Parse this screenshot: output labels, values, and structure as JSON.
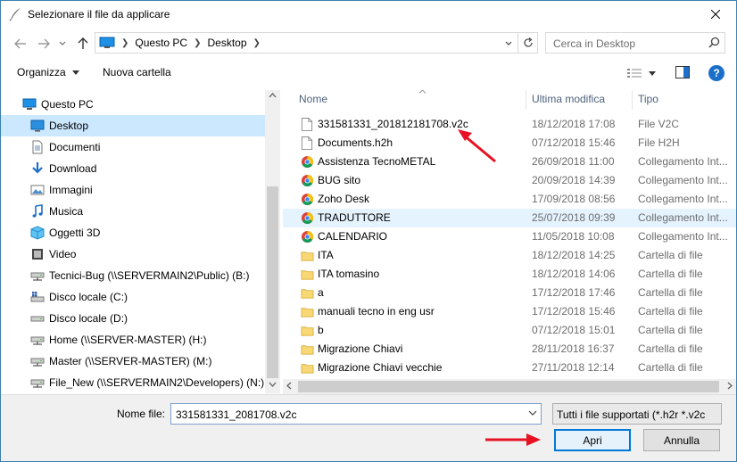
{
  "window": {
    "title": "Selezionare il file da applicare"
  },
  "address": {
    "crumbs": [
      "Questo PC",
      "Desktop"
    ]
  },
  "search": {
    "placeholder": "Cerca in Desktop"
  },
  "toolbar": {
    "organize": "Organizza",
    "new_folder": "Nuova cartella",
    "help": "?"
  },
  "nav": {
    "items": [
      {
        "label": "Questo PC",
        "icon": "pc-icon"
      },
      {
        "label": "Desktop",
        "icon": "desktop-icon",
        "selected": true
      },
      {
        "label": "Documenti",
        "icon": "documents-icon"
      },
      {
        "label": "Download",
        "icon": "download-icon"
      },
      {
        "label": "Immagini",
        "icon": "pictures-icon"
      },
      {
        "label": "Musica",
        "icon": "music-icon"
      },
      {
        "label": "Oggetti 3D",
        "icon": "3d-objects-icon"
      },
      {
        "label": "Video",
        "icon": "video-icon"
      },
      {
        "label": "Tecnici-Bug (\\\\SERVERMAIN2\\Public) (B:)",
        "icon": "network-drive-icon"
      },
      {
        "label": "Disco locale (C:)",
        "icon": "system-drive-icon"
      },
      {
        "label": "Disco locale (D:)",
        "icon": "drive-icon"
      },
      {
        "label": "Home (\\\\SERVER-MASTER) (H:)",
        "icon": "network-drive-icon"
      },
      {
        "label": "Master (\\\\SERVER-MASTER) (M:)",
        "icon": "network-drive-icon"
      },
      {
        "label": "File_New (\\\\SERVERMAIN2\\Developers) (N:)",
        "icon": "network-drive-icon"
      }
    ]
  },
  "columns": {
    "name": "Nome",
    "date": "Ultima modifica",
    "type": "Tipo"
  },
  "files": [
    {
      "name": "331581331_201812181708.v2c",
      "date": "18/12/2018 17:08",
      "type": "File V2C",
      "icon": "file-icon"
    },
    {
      "name": "Documents.h2h",
      "date": "07/12/2018 15:46",
      "type": "File H2H",
      "icon": "file-icon"
    },
    {
      "name": "Assistenza TecnoMETAL",
      "date": "26/09/2018 11:00",
      "type": "Collegamento Int...",
      "icon": "chrome-shortcut-icon"
    },
    {
      "name": "BUG sito",
      "date": "20/09/2018 14:39",
      "type": "Collegamento Int...",
      "icon": "chrome-shortcut-icon"
    },
    {
      "name": "Zoho Desk",
      "date": "17/09/2018 08:56",
      "type": "Collegamento Int...",
      "icon": "chrome-shortcut-icon"
    },
    {
      "name": "TRADUTTORE",
      "date": "25/07/2018 09:39",
      "type": "Collegamento Int...",
      "icon": "chrome-shortcut-icon",
      "hover": true
    },
    {
      "name": "CALENDARIO",
      "date": "11/05/2018 10:08",
      "type": "Collegamento Int...",
      "icon": "chrome-shortcut-icon"
    },
    {
      "name": "ITA",
      "date": "18/12/2018 14:25",
      "type": "Cartella di file",
      "icon": "folder-icon"
    },
    {
      "name": "ITA tomasino",
      "date": "18/12/2018 14:06",
      "type": "Cartella di file",
      "icon": "folder-icon"
    },
    {
      "name": "a",
      "date": "17/12/2018 17:46",
      "type": "Cartella di file",
      "icon": "folder-icon"
    },
    {
      "name": "manuali tecno in eng usr",
      "date": "17/12/2018 15:46",
      "type": "Cartella di file",
      "icon": "folder-icon"
    },
    {
      "name": "b",
      "date": "07/12/2018 15:01",
      "type": "Cartella di file",
      "icon": "folder-icon"
    },
    {
      "name": "Migrazione Chiavi",
      "date": "28/11/2018 16:37",
      "type": "Cartella di file",
      "icon": "folder-icon"
    },
    {
      "name": "Migrazione Chiavi vecchie",
      "date": "27/11/2018 12:14",
      "type": "Cartella di file",
      "icon": "folder-icon"
    }
  ],
  "bottom": {
    "filename_label": "Nome file:",
    "filename_value": "331581331_2081708.v2c",
    "filetype_value": "Tutti i file supportati (*.h2r *.v2c",
    "open_label": "Apri",
    "cancel_label": "Annulla"
  },
  "colors": {
    "accent": "#0078d7",
    "selection": "#cce8ff",
    "annotation": "#e81123"
  }
}
